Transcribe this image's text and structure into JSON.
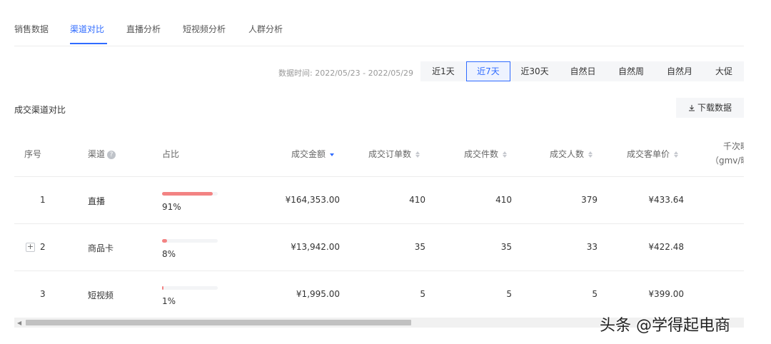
{
  "tabs": [
    {
      "label": "销售数据",
      "active": false
    },
    {
      "label": "渠道对比",
      "active": true
    },
    {
      "label": "直播分析",
      "active": false
    },
    {
      "label": "短视频分析",
      "active": false
    },
    {
      "label": "人群分析",
      "active": false
    }
  ],
  "time_filter": {
    "label": "数据时间: 2022/05/23 - 2022/05/29",
    "options": [
      "近1天",
      "近7天",
      "近30天",
      "自然日",
      "自然周",
      "自然月",
      "大促"
    ],
    "selected": "近7天"
  },
  "section": {
    "title": "成交渠道对比",
    "download_label": "下载数据",
    "download_icon": "download-icon"
  },
  "table": {
    "headers": {
      "index": "序号",
      "channel": "渠道",
      "share": "占比",
      "gmv": "成交金额",
      "orders": "成交订单数",
      "items": "成交件数",
      "buyers": "成交人数",
      "aov": "成交客单价",
      "gpm_line1": "千次曝",
      "gpm_line2": "（gmv/曝"
    },
    "sorted_column": "gmv",
    "sort_direction": "desc",
    "rows": [
      {
        "index": "1",
        "channel": "直播",
        "share_label": "91%",
        "share": 91,
        "gmv": "¥164,353.00",
        "orders": "410",
        "items": "410",
        "buyers": "379",
        "aov": "¥433.64",
        "expandable": false
      },
      {
        "index": "2",
        "channel": "商品卡",
        "share_label": "8%",
        "share": 8,
        "gmv": "¥13,942.00",
        "orders": "35",
        "items": "35",
        "buyers": "33",
        "aov": "¥422.48",
        "expandable": true
      },
      {
        "index": "3",
        "channel": "短视频",
        "share_label": "1%",
        "share": 1,
        "gmv": "¥1,995.00",
        "orders": "5",
        "items": "5",
        "buyers": "5",
        "aov": "¥399.00",
        "expandable": false
      }
    ]
  },
  "colors": {
    "accent": "#2f6bff",
    "share_bar": "#f38383"
  },
  "watermark": "头条 @学得起电商"
}
